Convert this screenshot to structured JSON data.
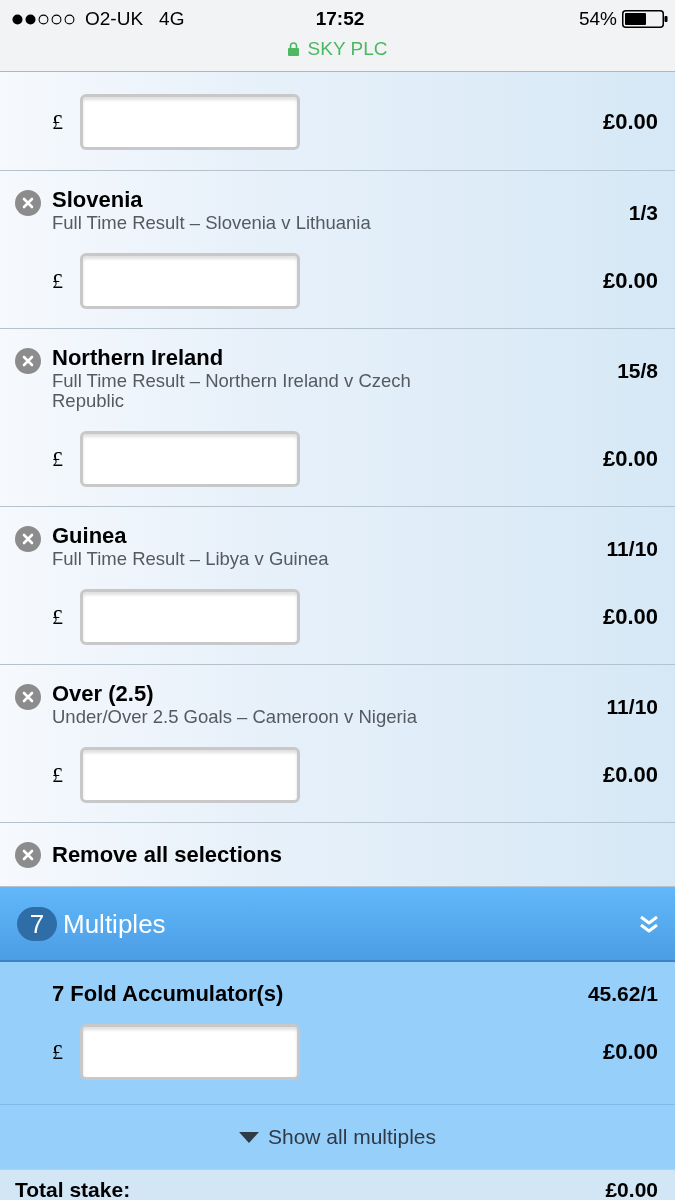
{
  "status_bar": {
    "carrier": "O2-UK",
    "network": "4G",
    "time": "17:52",
    "battery": "54%"
  },
  "site": {
    "name": "SKY PLC",
    "secure": true
  },
  "singles": [
    {
      "currency": "£",
      "returns": "£0.00"
    },
    {
      "selection": "Slovenia",
      "market": "Full Time Result – Slovenia v Lithuania",
      "odds": "1/3",
      "currency": "£",
      "returns": "£0.00"
    },
    {
      "selection": "Northern Ireland",
      "market": "Full Time Result – Northern Ireland v Czech Republic",
      "odds": "15/8",
      "currency": "£",
      "returns": "£0.00"
    },
    {
      "selection": "Guinea",
      "market": "Full Time Result – Libya v Guinea",
      "odds": "11/10",
      "currency": "£",
      "returns": "£0.00"
    },
    {
      "selection": "Over (2.5)",
      "market": "Under/Over 2.5 Goals – Cameroon v Nigeria",
      "odds": "11/10",
      "currency": "£",
      "returns": "£0.00"
    }
  ],
  "remove_all": {
    "label": "Remove all selections"
  },
  "multiples": {
    "count": "7",
    "title": "Multiples",
    "bets": [
      {
        "title": "7 Fold Accumulator(s)",
        "odds": "45.62/1",
        "currency": "£",
        "returns": "£0.00"
      }
    ],
    "show_all": "Show all multiples"
  },
  "totals": [
    {
      "label": "Total stake:",
      "value": "£0.00"
    }
  ]
}
